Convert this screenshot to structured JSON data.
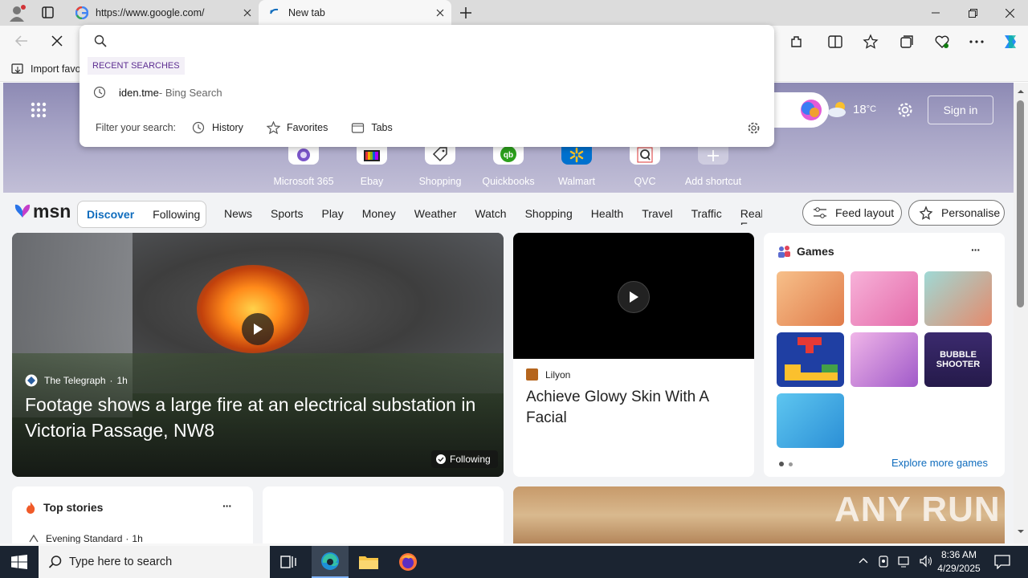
{
  "tabs": [
    {
      "title": "https://www.google.com/",
      "active": false
    },
    {
      "title": "New tab",
      "active": true
    }
  ],
  "window_controls": [
    "minimize-icon",
    "restore-icon",
    "close-icon"
  ],
  "address_bar": {
    "value": "",
    "placeholder": ""
  },
  "bookmarks": {
    "import_label": "Import favo"
  },
  "dropdown": {
    "recent_header": "RECENT SEARCHES",
    "recent_items": [
      {
        "query": "iden.tme",
        "source": " - Bing Search"
      }
    ],
    "filter_label": "Filter your search:",
    "filters": [
      "History",
      "Favorites",
      "Tabs"
    ]
  },
  "hero": {
    "sign_in": "Sign in",
    "weather_temp": "18",
    "weather_unit": "°C",
    "shortcuts": [
      "Microsoft 365",
      "Ebay",
      "Shopping",
      "Quickbooks",
      "Walmart",
      "QVC",
      "Add shortcut"
    ]
  },
  "msn": {
    "logo": "msn",
    "tabs": [
      "Discover",
      "Following"
    ],
    "categories": [
      "News",
      "Sports",
      "Play",
      "Money",
      "Weather",
      "Watch",
      "Shopping",
      "Health",
      "Travel",
      "Traffic",
      "Real E"
    ],
    "feed_layout": "Feed layout",
    "personalise": "Personalise"
  },
  "main_card": {
    "source": "The Telegraph",
    "age": "1h",
    "headline": "Footage shows a large fire at an electrical substation in Victoria Passage, NW8",
    "badge": "Following"
  },
  "video_card": {
    "source": "Lilyon",
    "headline": "Achieve Glowy Skin With A Facial"
  },
  "games": {
    "title": "Games",
    "more": "···",
    "explore": "Explore more games",
    "tiles": [
      "game-tile-cook",
      "game-tile-dressup",
      "game-tile-doctor",
      "game-tile-blocks",
      "game-tile-makeup",
      "game-tile-bubble-shooter",
      "game-tile-foot"
    ],
    "bubble_text": "BUBBLE SHOOTER"
  },
  "top_stories": {
    "title": "Top stories",
    "more": "···",
    "first_source": "Evening Standard",
    "first_age": "1h"
  },
  "watermark": "ANY RUN",
  "taskbar": {
    "search_placeholder": "Type here to search",
    "time": "8:36 AM",
    "date": "4/29/2025"
  },
  "colors": {
    "accent": "#0f6cbd",
    "tabstrip": "#dcdcdc",
    "taskbar": "#1b2431",
    "purple_header": "#5c2d91"
  }
}
